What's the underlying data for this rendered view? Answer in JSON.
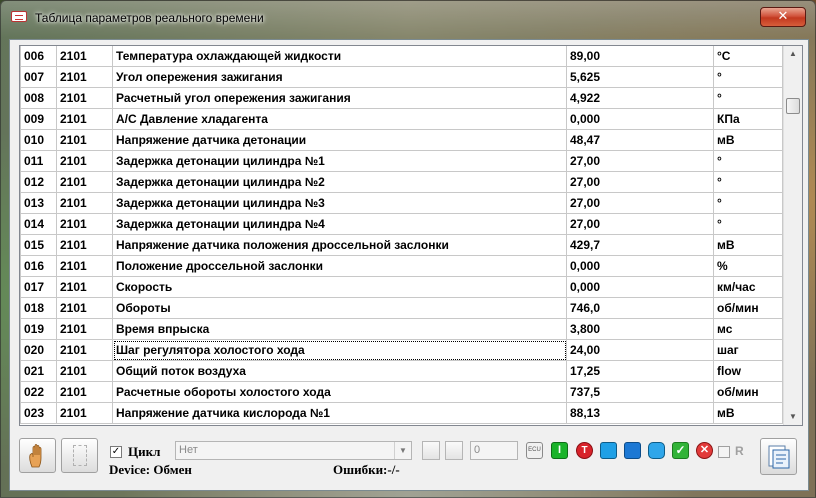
{
  "window": {
    "title": "Таблица параметров реального времени",
    "close_label": "✕"
  },
  "table": {
    "rows": [
      {
        "num": "006",
        "code": "2101",
        "name": "Температура охлаждающей жидкости",
        "value": "89,00",
        "unit": "°C"
      },
      {
        "num": "007",
        "code": "2101",
        "name": "Угол опережения зажигания",
        "value": "5,625",
        "unit": "°"
      },
      {
        "num": "008",
        "code": "2101",
        "name": "Расчетный угол опережения зажигания",
        "value": "4,922",
        "unit": "°"
      },
      {
        "num": "009",
        "code": "2101",
        "name": "A/C Давление хладагента",
        "value": "0,000",
        "unit": "КПа"
      },
      {
        "num": "010",
        "code": "2101",
        "name": "Напряжение датчика детонации",
        "value": "48,47",
        "unit": "мВ"
      },
      {
        "num": "011",
        "code": "2101",
        "name": "Задержка детонации цилиндра №1",
        "value": "27,00",
        "unit": "°"
      },
      {
        "num": "012",
        "code": "2101",
        "name": "Задержка детонации цилиндра №2",
        "value": "27,00",
        "unit": "°"
      },
      {
        "num": "013",
        "code": "2101",
        "name": "Задержка детонации цилиндра №3",
        "value": "27,00",
        "unit": "°"
      },
      {
        "num": "014",
        "code": "2101",
        "name": "Задержка детонации цилиндра №4",
        "value": "27,00",
        "unit": "°"
      },
      {
        "num": "015",
        "code": "2101",
        "name": "Напряжение датчика положения дроссельной заслонки",
        "value": "429,7",
        "unit": "мВ"
      },
      {
        "num": "016",
        "code": "2101",
        "name": "Положение дроссельной заслонки",
        "value": "0,000",
        "unit": "%"
      },
      {
        "num": "017",
        "code": "2101",
        "name": "Скорость",
        "value": "0,000",
        "unit": "км/час"
      },
      {
        "num": "018",
        "code": "2101",
        "name": "Обороты",
        "value": "746,0",
        "unit": "об/мин"
      },
      {
        "num": "019",
        "code": "2101",
        "name": "Время впрыска",
        "value": "3,800",
        "unit": "мс"
      },
      {
        "num": "020",
        "code": "2101",
        "name": "Шаг регулятора холостого хода",
        "value": "24,00",
        "unit": "шаг"
      },
      {
        "num": "021",
        "code": "2101",
        "name": "Общий поток воздуха",
        "value": "17,25",
        "unit": "flow"
      },
      {
        "num": "022",
        "code": "2101",
        "name": "Расчетные обороты холостого хода",
        "value": "737,5",
        "unit": "об/мин"
      },
      {
        "num": "023",
        "code": "2101",
        "name": "Напряжение датчика кислорода №1",
        "value": "88,13",
        "unit": "мВ"
      }
    ],
    "focused_row": 14
  },
  "toolbar": {
    "cycle_label": "Цикл",
    "cycle_checked": true,
    "combo_value": "Нет",
    "number_value": "0",
    "ecu_label": "ECU",
    "green_i_label": "I",
    "red_t_label": "T",
    "check_label": "✓",
    "x_label": "✕",
    "r_label": "R"
  },
  "status": {
    "device": "Device: Обмен",
    "errors": "Ошибки:-/-"
  },
  "icons": [
    "app-icon",
    "hand-icon",
    "document-icon",
    "refresh-icon",
    "ecu-icon",
    "info-icon",
    "test-icon",
    "monitor-icon",
    "list-icon",
    "display-icon",
    "ok-icon",
    "cancel-icon"
  ]
}
